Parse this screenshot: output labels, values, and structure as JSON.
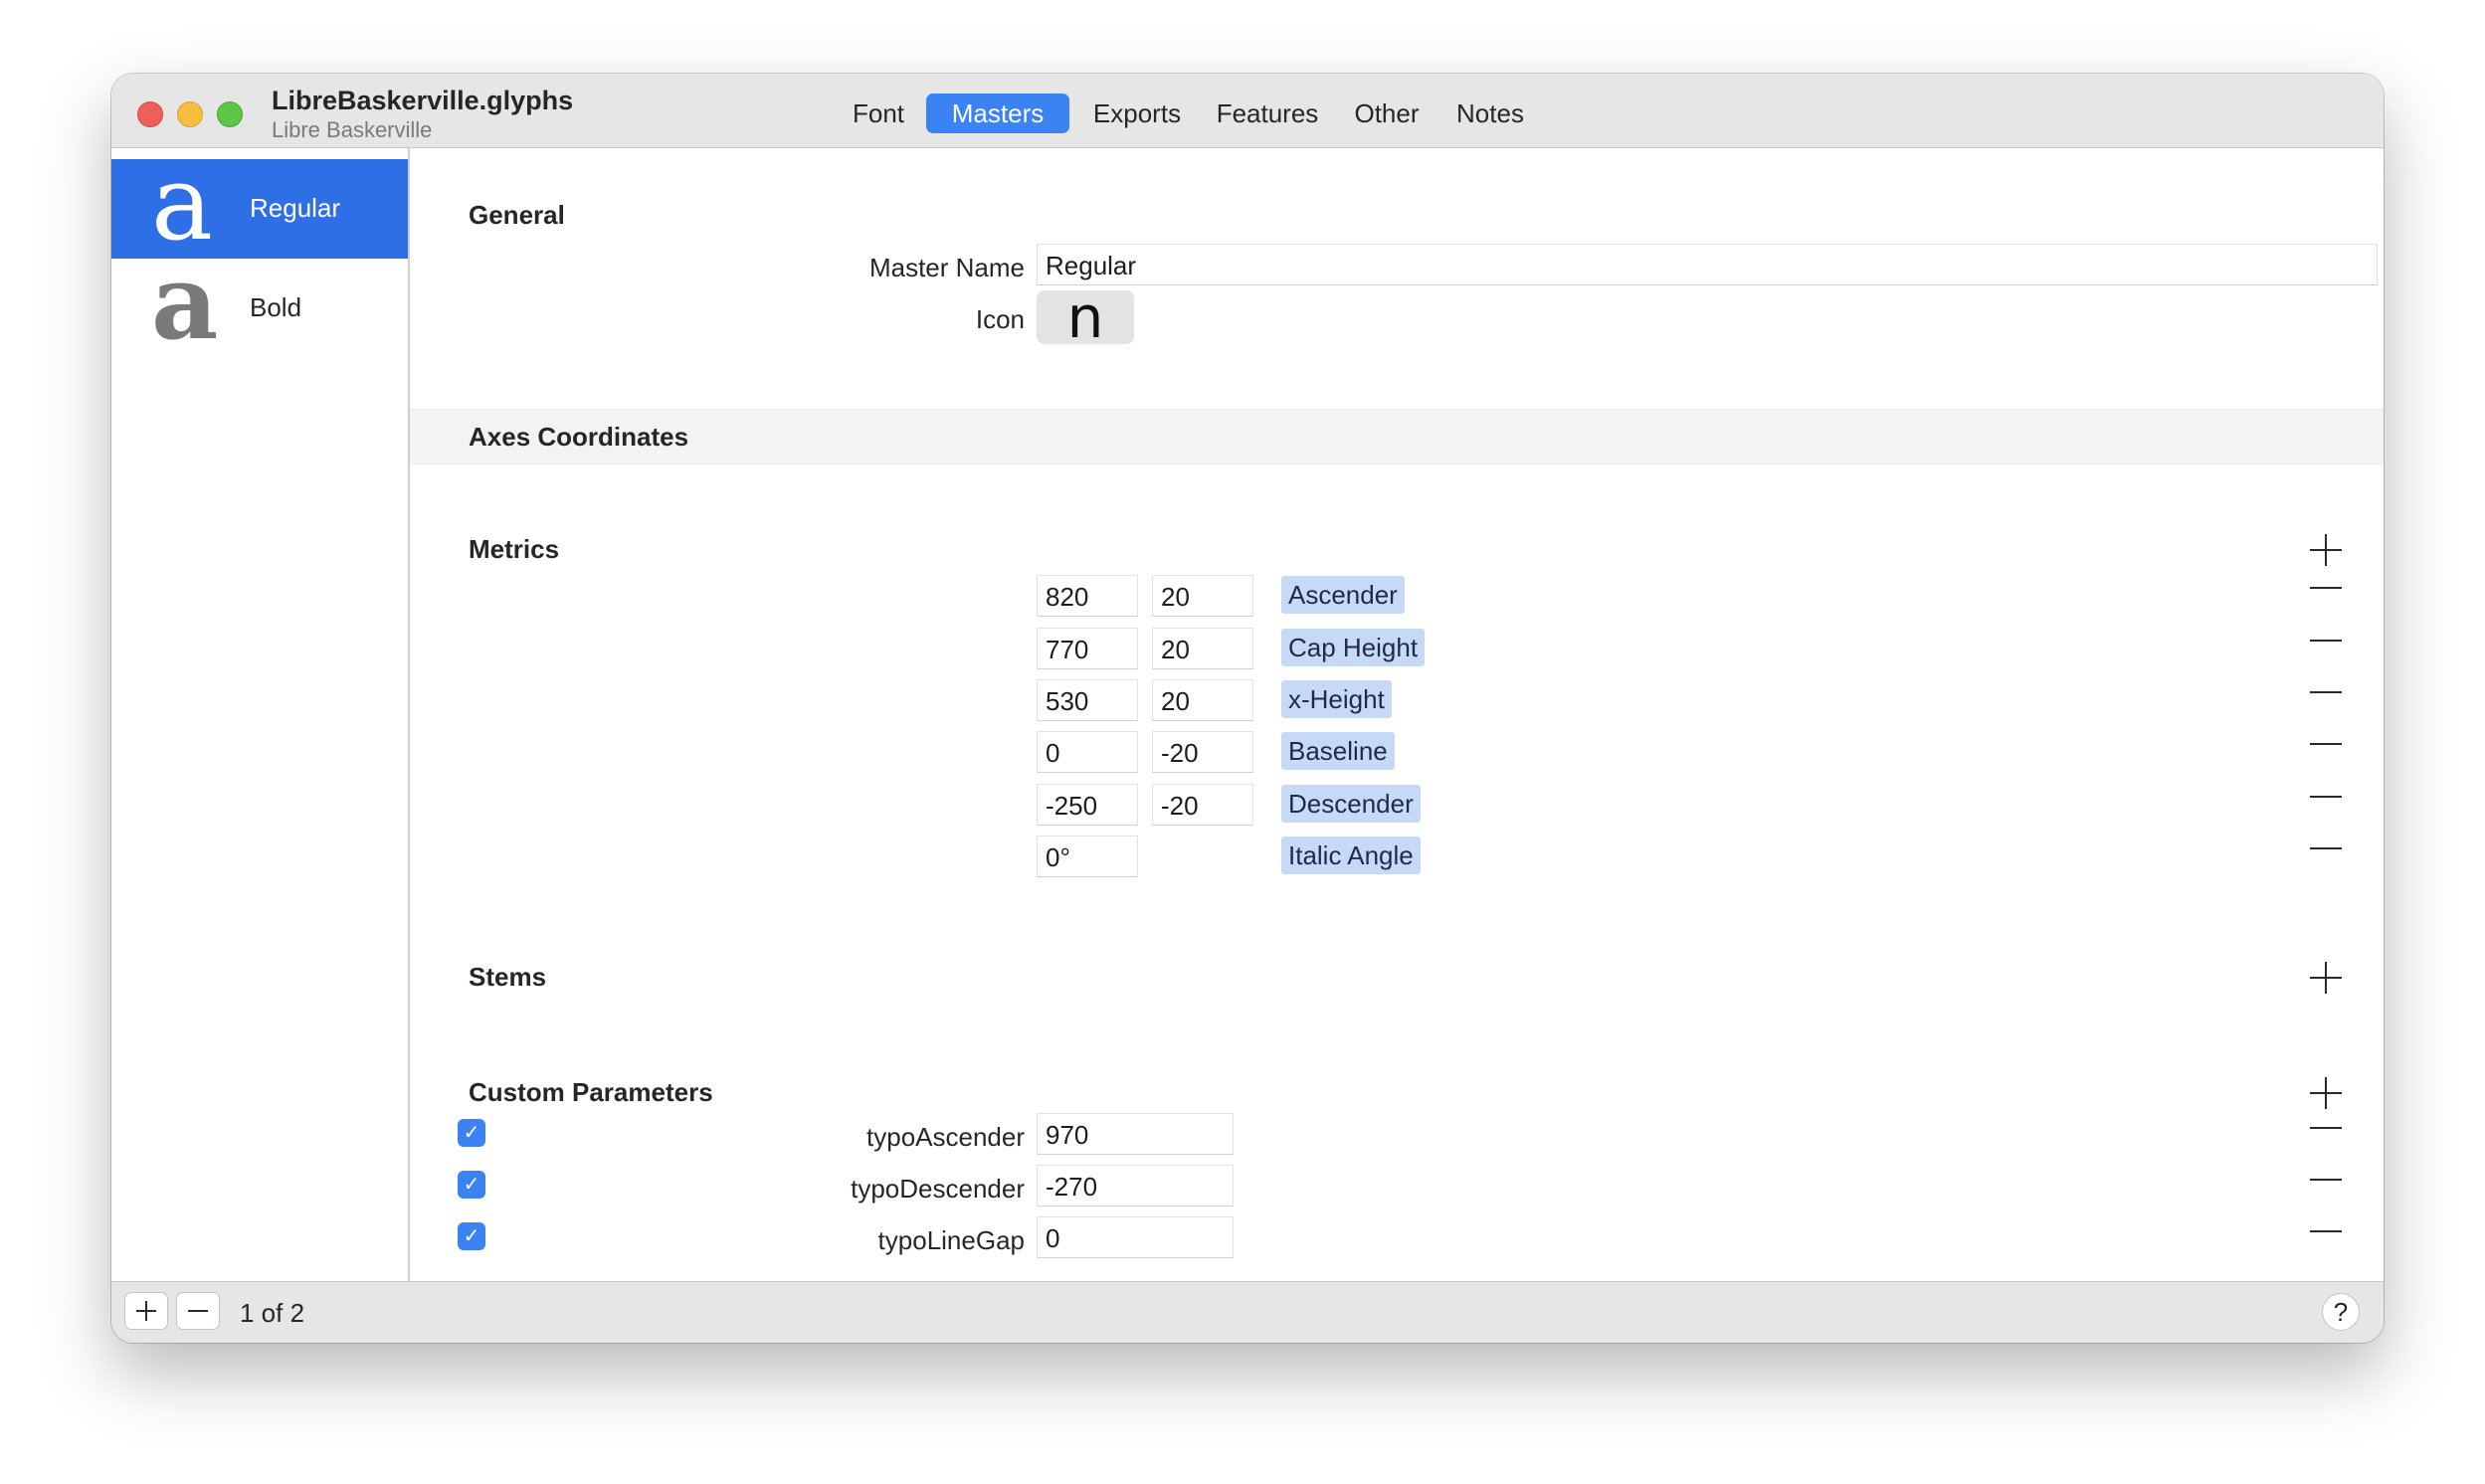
{
  "window": {
    "title": "LibreBaskerville.glyphs",
    "subtitle": "Libre Baskerville"
  },
  "tabs": [
    {
      "label": "Font"
    },
    {
      "label": "Masters",
      "active": true
    },
    {
      "label": "Exports"
    },
    {
      "label": "Features"
    },
    {
      "label": "Other"
    },
    {
      "label": "Notes"
    }
  ],
  "sidebar": {
    "masters": [
      {
        "glyph": "a",
        "label": "Regular",
        "selected": true
      },
      {
        "glyph": "a",
        "label": "Bold",
        "selected": false
      }
    ]
  },
  "general": {
    "title": "General",
    "master_name_label": "Master Name",
    "master_name_value": "Regular",
    "icon_label": "Icon",
    "icon_glyph": "n"
  },
  "axes": {
    "title": "Axes Coordinates"
  },
  "metrics": {
    "title": "Metrics",
    "rows": [
      {
        "value": "820",
        "overshoot": "20",
        "name": "Ascender"
      },
      {
        "value": "770",
        "overshoot": "20",
        "name": "Cap Height"
      },
      {
        "value": "530",
        "overshoot": "20",
        "name": "x-Height"
      },
      {
        "value": "0",
        "overshoot": "-20",
        "name": "Baseline"
      },
      {
        "value": "-250",
        "overshoot": "-20",
        "name": "Descender"
      },
      {
        "value": "0°",
        "overshoot": "",
        "name": "Italic Angle"
      }
    ]
  },
  "stems": {
    "title": "Stems"
  },
  "custom_parameters": {
    "title": "Custom Parameters",
    "rows": [
      {
        "enabled": true,
        "name": "typoAscender",
        "value": "970"
      },
      {
        "enabled": true,
        "name": "typoDescender",
        "value": "-270"
      },
      {
        "enabled": true,
        "name": "typoLineGap",
        "value": "0"
      }
    ]
  },
  "footer": {
    "count_text": "1 of 2",
    "help_label": "?"
  },
  "colors": {
    "accent": "#3b82f2",
    "selection": "#2f6fe6",
    "metric_tag": "#c6daf8"
  }
}
